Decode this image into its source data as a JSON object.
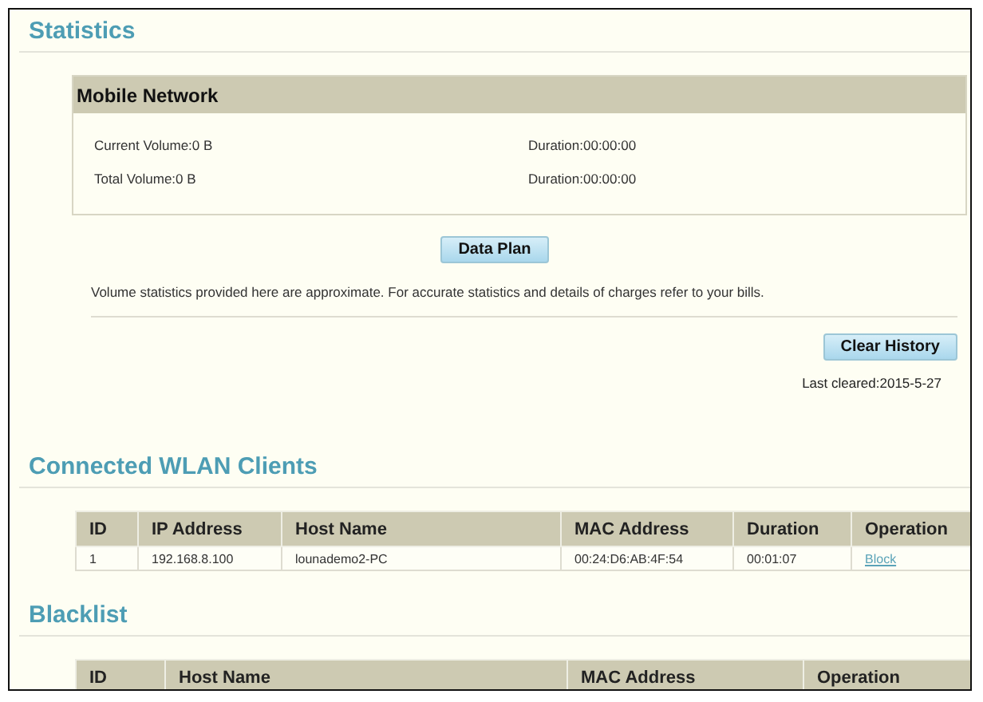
{
  "statistics": {
    "title": "Statistics",
    "mobile_network": {
      "title": "Mobile Network",
      "rows": [
        {
          "volume": "Current Volume:0 B",
          "duration": "Duration:00:00:00"
        },
        {
          "volume": "Total Volume:0 B",
          "duration": "Duration:00:00:00"
        }
      ]
    },
    "data_plan_button": "Data Plan",
    "note": "Volume statistics provided here are approximate. For accurate statistics and details of charges refer to your bills.",
    "clear_history_button": "Clear History",
    "last_cleared": "Last cleared:2015-5-27"
  },
  "wlan_clients": {
    "title": "Connected WLAN Clients",
    "columns": [
      "ID",
      "IP Address",
      "Host Name",
      "MAC Address",
      "Duration",
      "Operation"
    ],
    "rows": [
      {
        "id": "1",
        "ip": "192.168.8.100",
        "host": "lounademo2-PC",
        "mac": "00:24:D6:AB:4F:54",
        "duration": "00:01:07",
        "operation": "Block"
      }
    ]
  },
  "blacklist": {
    "title": "Blacklist",
    "columns": [
      "ID",
      "Host Name",
      "MAC Address",
      "Operation"
    ]
  }
}
